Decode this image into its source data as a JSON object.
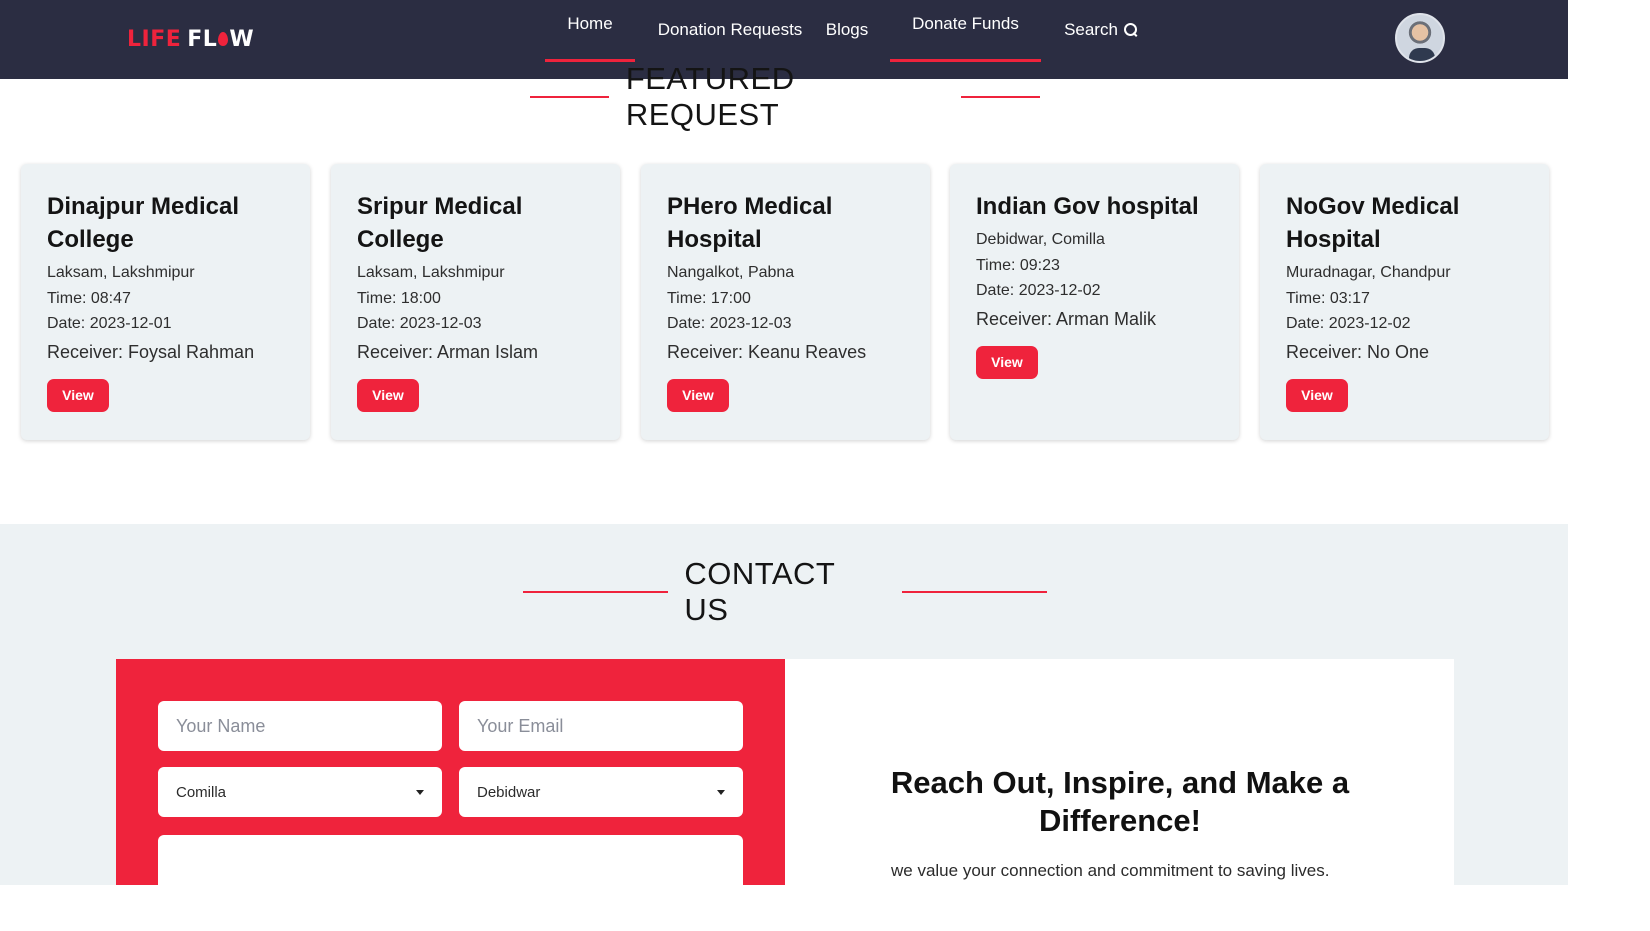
{
  "nav": {
    "logo_left": "LIFE",
    "logo_right_a": "FL",
    "logo_right_b": "W",
    "home": "Home",
    "donation_requests": "Donation Requests",
    "blogs": "Blogs",
    "donate_funds": "Donate Funds",
    "search": "Search"
  },
  "featured": {
    "title": "FEATURED REQUEST",
    "cards": [
      {
        "hospital": "Dinajpur Medical College",
        "location": "Laksam, Lakshmipur",
        "time": "Time: 08:47",
        "date": "Date: 2023-12-01",
        "receiver": "Receiver: Foysal Rahman",
        "button": "View"
      },
      {
        "hospital": "Sripur Medical College",
        "location": "Laksam, Lakshmipur",
        "time": "Time: 18:00",
        "date": "Date: 2023-12-03",
        "receiver": "Receiver: Arman Islam",
        "button": "View"
      },
      {
        "hospital": "PHero Medical Hospital",
        "location": "Nangalkot, Pabna",
        "time": "Time: 17:00",
        "date": "Date: 2023-12-03",
        "receiver": "Receiver: Keanu Reaves",
        "button": "View"
      },
      {
        "hospital": "Indian Gov hospital",
        "location": "Debidwar, Comilla",
        "time": "Time: 09:23",
        "date": "Date: 2023-12-02",
        "receiver": "Receiver: Arman Malik",
        "button": "View"
      },
      {
        "hospital": "NoGov Medical Hospital",
        "location": "Muradnagar, Chandpur",
        "time": "Time: 03:17",
        "date": "Date: 2023-12-02",
        "receiver": "Receiver: No One",
        "button": "View"
      }
    ]
  },
  "contact": {
    "title": "CONTACT US",
    "name_placeholder": "Your Name",
    "email_placeholder": "Your Email",
    "district_selected": "Comilla",
    "upazila_selected": "Debidwar",
    "heading": "Reach Out, Inspire, and Make a Difference!",
    "text": "we value your connection and commitment to saving lives."
  },
  "colors": {
    "accent": "#ef233c",
    "navbar": "#2b2d42",
    "card_bg": "#edf2f4"
  }
}
